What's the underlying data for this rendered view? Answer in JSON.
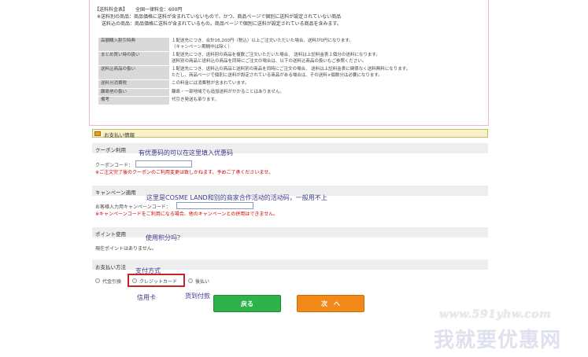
{
  "shipping": {
    "heading_bracket": "【送料料金表】",
    "heading_value": "全国一律料金：600円",
    "notes": [
      "※送料別の商品：商品価格に送料が含まれていないもので、かつ、商品ページで個別に送料が設定されていない商品",
      "送料込の商品：商品価格に送料が含まれているもの。商品ページで個別に送料が設定されている商品を含みます。"
    ],
    "rows": [
      {
        "label": "高額購入割引特典",
        "lines": [
          "１配送先につき、合計16,200円（税込）以上ご注文いただいた場合、送料が0円になります。",
          "（キャンペーン期間中は除く）"
        ]
      },
      {
        "label": "まとめ買い時の扱い",
        "lines": [
          "１配送先につき、送料別の商品を複数ご注文いただいた場合、 送料は上記料金表１個分の送料になります。",
          "送料別の商品と送料込の商品を同時にご注文の場合は、以下の送料込商品の扱いもご参照ください。"
        ]
      },
      {
        "label": "送料込商品の扱い",
        "lines": [
          "１配送先につき、送料込の商品と送料別の商品を同時にご注文の場合、 送料は上記料金表に関係なく送料無料になります。",
          "ただし、商品ページで個別に送料が設定されている商品がある場合は、その送料×個数分は必要になります。"
        ]
      },
      {
        "label": "送料分消費税",
        "lines": [
          "この料金には消費税が含まれています。"
        ]
      },
      {
        "label": "離島他の扱い",
        "lines": [
          "離島・一部地域でも追加送料がかかることはありません。"
        ]
      },
      {
        "label": "備考",
        "lines": [
          "代引き発送も承ります。"
        ]
      }
    ]
  },
  "payment_info": {
    "header": "お支払い情報",
    "coupon": {
      "title": "クーポン利用",
      "field_label": "クーポンコード：",
      "warning": "※ご注文完了後のクーポンのご利用変更は致しかねます。予めご了承くださいませ。",
      "annotation": "有优惠码的可以在这里填入优惠码"
    },
    "campaign": {
      "title": "キャンペーン適用",
      "field_label": "お客様入力用キャンペーンコード：",
      "warning": "※キャンペーンコードをご利用になる場合、他のキャンペーンとの併用はできません。",
      "annotation": "这里是COSME LAND和别的商家合作活动的活动码，一般用不上"
    },
    "points": {
      "title": "ポイント使用",
      "text": "現在ポイントはありません。",
      "annotation": "使用积分吗？"
    },
    "method": {
      "title": "お支払い方法",
      "annotation": "支付方式",
      "options": [
        {
          "label": "代金引換",
          "selected": false
        },
        {
          "label": "クレジットカード",
          "selected": false
        },
        {
          "label": "後払い",
          "selected": false
        }
      ],
      "annotation_credit": "信用卡",
      "annotation_later": "货到付款"
    }
  },
  "buttons": {
    "back": "戻る",
    "next": "次　へ"
  },
  "colors": {
    "back_button": "#2fb24a",
    "next_button": "#f28a1a",
    "highlight_box": "#cc2222",
    "header_bg": "#f7f2c8"
  },
  "watermark": {
    "url": "www.591yhw.com",
    "text": "我就要优惠网"
  }
}
